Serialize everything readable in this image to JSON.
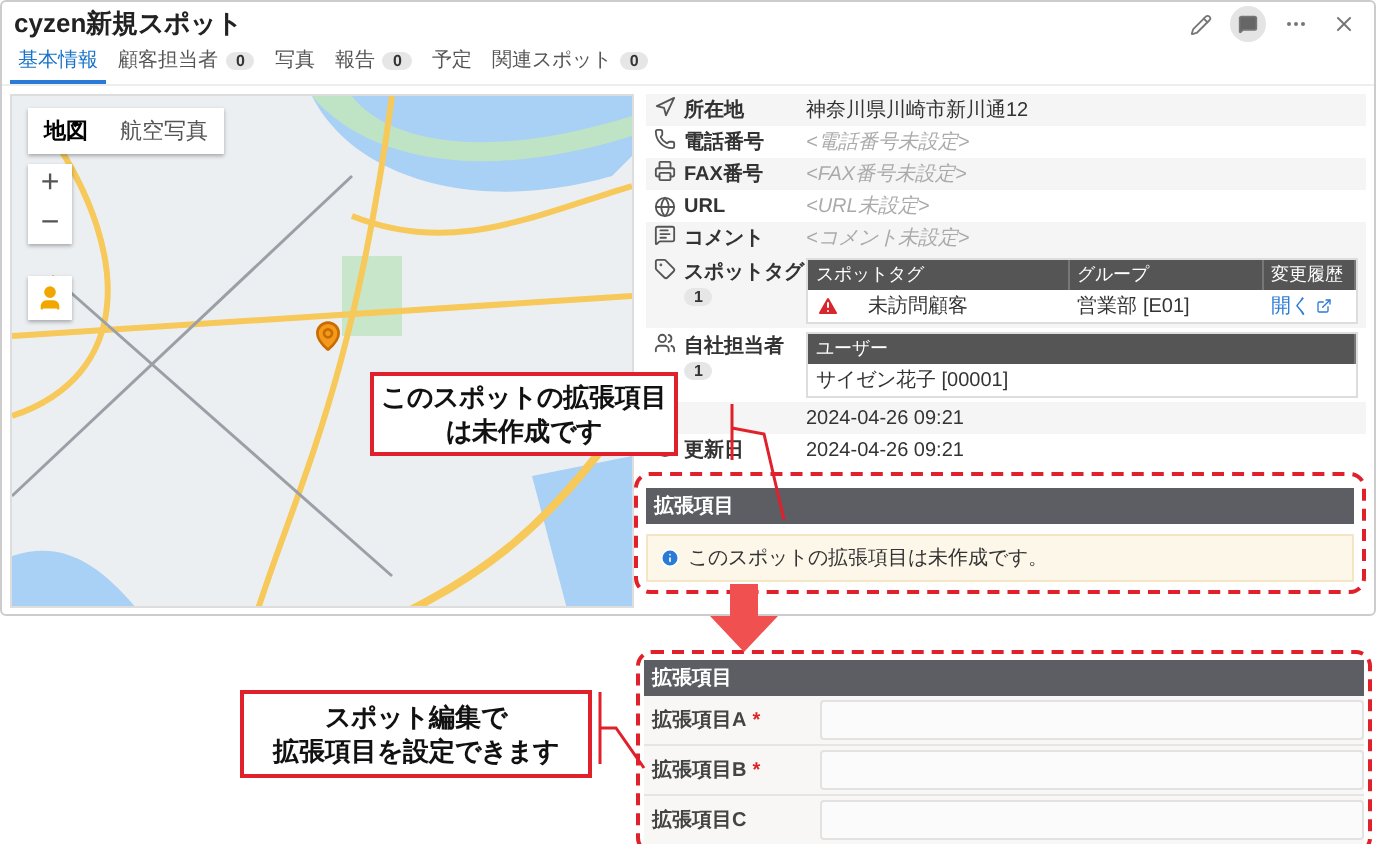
{
  "window": {
    "title": "cyzen新規スポット"
  },
  "tabs": [
    {
      "label": "基本情報",
      "selected": true
    },
    {
      "label": "顧客担当者",
      "count": "0",
      "selected": false
    },
    {
      "label": "写真",
      "selected": false
    },
    {
      "label": "報告",
      "count": "0",
      "selected": false
    },
    {
      "label": "予定",
      "selected": false
    },
    {
      "label": "関連スポット",
      "count": "0",
      "selected": false
    }
  ],
  "map": {
    "type_buttons": [
      {
        "label": "地図",
        "selected": true
      },
      {
        "label": "航空写真",
        "selected": false
      }
    ],
    "zoom_in": "+",
    "zoom_out": "−"
  },
  "details": [
    {
      "label": "所在地",
      "value": "神奈川県川崎市新川通12",
      "empty": false
    },
    {
      "label": "電話番号",
      "value": "<電話番号未設定>",
      "empty": true
    },
    {
      "label": "FAX番号",
      "value": "<FAX番号未設定>",
      "empty": true
    },
    {
      "label": "URL",
      "value": "<URL未設定>",
      "empty": true
    },
    {
      "label": "コメント",
      "value": "<コメント未設定>",
      "empty": true
    }
  ],
  "spot_tags": {
    "label": "スポットタグ",
    "count": "1",
    "columns": [
      "スポットタグ",
      "グループ",
      "変更履歴"
    ],
    "rows": [
      {
        "tag": "未訪問顧客",
        "group": "営業部 [E01]",
        "link": "開く"
      }
    ]
  },
  "owners": {
    "label": "自社担当者",
    "count": "1",
    "columns": [
      "ユーザー"
    ],
    "rows": [
      "サイゼン花子 [00001]"
    ]
  },
  "dates": [
    {
      "value": "2024-04-26 09:21"
    },
    {
      "label": "更新日",
      "value": "2024-04-26 09:21"
    }
  ],
  "extension": {
    "title": "拡張項目",
    "message": "このスポットの拡張項目は未作成です。"
  },
  "edit_form": {
    "title": "拡張項目",
    "fields": [
      {
        "label": "拡張項目A",
        "marker": "*"
      },
      {
        "label": "拡張項目B",
        "marker": "*"
      },
      {
        "label": "拡張項目C"
      }
    ]
  },
  "callouts": [
    {
      "lines": [
        "このスポットの拡張項目",
        "は未作成です"
      ]
    },
    {
      "lines": [
        "スポット編集で",
        "拡張項目を設定できます"
      ]
    }
  ]
}
